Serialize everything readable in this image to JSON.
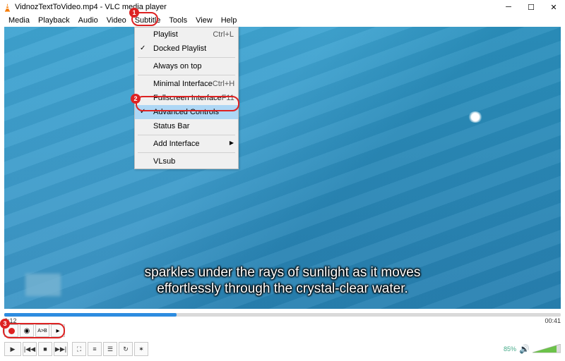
{
  "window": {
    "title": "VidnozTextToVideo.mp4 - VLC media player"
  },
  "menubar": {
    "items": [
      "Media",
      "Playback",
      "Audio",
      "Video",
      "Subtitle",
      "Tools",
      "View",
      "Help"
    ]
  },
  "view_menu": {
    "items": [
      {
        "label": "Playlist",
        "shortcut": "Ctrl+L",
        "checked": false
      },
      {
        "label": "Docked Playlist",
        "shortcut": "",
        "checked": true
      },
      {
        "label": "Always on top",
        "shortcut": "",
        "checked": false
      },
      {
        "label": "Minimal Interface",
        "shortcut": "Ctrl+H",
        "checked": false
      },
      {
        "label": "Fullscreen Interface",
        "shortcut": "F11",
        "checked": false
      },
      {
        "label": "Advanced Controls",
        "shortcut": "",
        "checked": true,
        "highlight": true
      },
      {
        "label": "Status Bar",
        "shortcut": "",
        "checked": false
      },
      {
        "label": "Add Interface",
        "shortcut": "",
        "submenu": true
      },
      {
        "label": "VLsub",
        "shortcut": "",
        "checked": false
      }
    ]
  },
  "subtitle_text": {
    "line1": "sparkles under the rays of sunlight as it moves",
    "line2": "effortlessly through the crystal-clear water."
  },
  "time": {
    "elapsed": "0:12",
    "total": "00:41"
  },
  "volume": {
    "percent": "85%"
  },
  "callouts": {
    "c1": "1",
    "c2": "2",
    "c3": "3"
  }
}
